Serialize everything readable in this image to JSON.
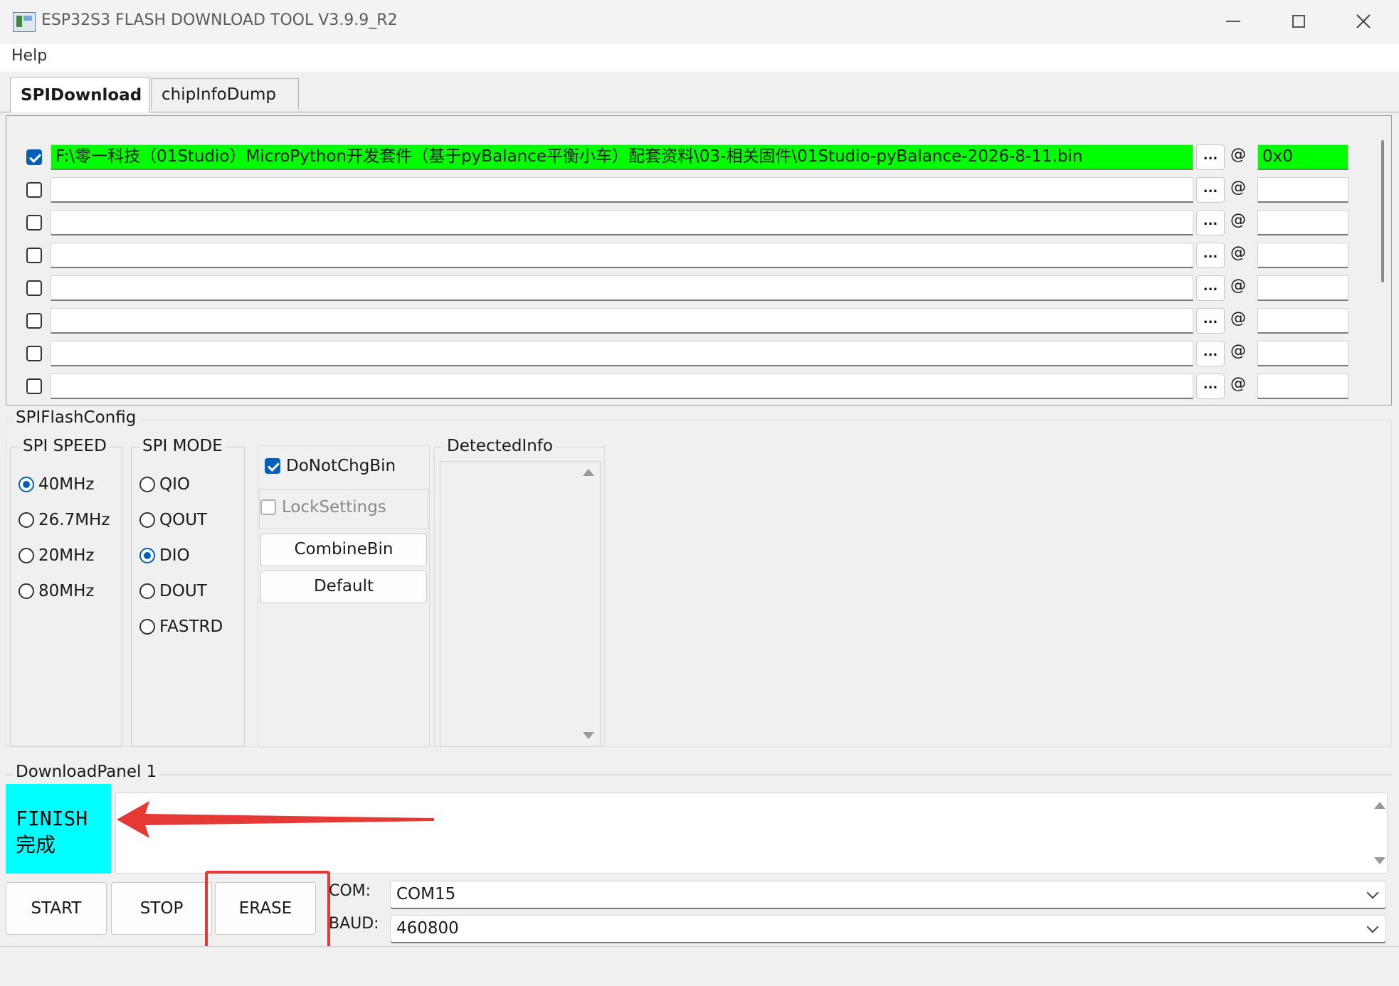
{
  "window": {
    "title": "ESP32S3 FLASH DOWNLOAD TOOL V3.9.9_R2"
  },
  "menu": {
    "help": "Help"
  },
  "tabs": [
    {
      "label": "SPIDownload",
      "active": true
    },
    {
      "label": "chipInfoDump",
      "active": false
    }
  ],
  "files": [
    {
      "checked": true,
      "path": "F:\\零一科技（01Studio）MicroPython开发套件（基于pyBalance平衡小车）配套资料\\03-相关固件\\01Studio-pyBalance-2026-8-11.bin",
      "browse": "...",
      "at": "@",
      "addr": "0x0"
    },
    {
      "checked": false,
      "path": "",
      "browse": "...",
      "at": "@",
      "addr": ""
    },
    {
      "checked": false,
      "path": "",
      "browse": "...",
      "at": "@",
      "addr": ""
    },
    {
      "checked": false,
      "path": "",
      "browse": "...",
      "at": "@",
      "addr": ""
    },
    {
      "checked": false,
      "path": "",
      "browse": "...",
      "at": "@",
      "addr": ""
    },
    {
      "checked": false,
      "path": "",
      "browse": "...",
      "at": "@",
      "addr": ""
    },
    {
      "checked": false,
      "path": "",
      "browse": "...",
      "at": "@",
      "addr": ""
    },
    {
      "checked": false,
      "path": "",
      "browse": "...",
      "at": "@",
      "addr": ""
    }
  ],
  "spi_flash_config": {
    "title": "SPIFlashConfig",
    "spi_speed": {
      "title": "SPI SPEED",
      "options": [
        "40MHz",
        "26.7MHz",
        "20MHz",
        "80MHz"
      ],
      "selected": "40MHz"
    },
    "spi_mode": {
      "title": "SPI MODE",
      "options": [
        "QIO",
        "QOUT",
        "DIO",
        "DOUT",
        "FASTRD"
      ],
      "selected": "DIO"
    },
    "do_not_chg_bin": {
      "label": "DoNotChgBin",
      "checked": true
    },
    "lock_settings": {
      "label": "LockSettings",
      "checked": false
    },
    "combine_bin": "CombineBin",
    "default": "Default",
    "detected_info": {
      "title": "DetectedInfo"
    }
  },
  "download_panel": {
    "title": "DownloadPanel 1",
    "status_line1": "FINISH",
    "status_line2": "完成",
    "status_color": "#00ffff",
    "start": "START",
    "stop": "STOP",
    "erase": "ERASE",
    "com_label": "COM:",
    "com_value": "COM15",
    "baud_label": "BAUD:",
    "baud_value": "460800"
  },
  "annotations": {
    "arrow_color": "#e53935",
    "highlight_color": "#e53935"
  },
  "icons": {
    "app": "app-icon",
    "minimize": "minimize-icon",
    "maximize": "maximize-icon",
    "close": "close-icon",
    "scroll_up": "scroll-up-icon",
    "scroll_down": "scroll-down-icon",
    "dropdown": "chevron-down-icon"
  }
}
